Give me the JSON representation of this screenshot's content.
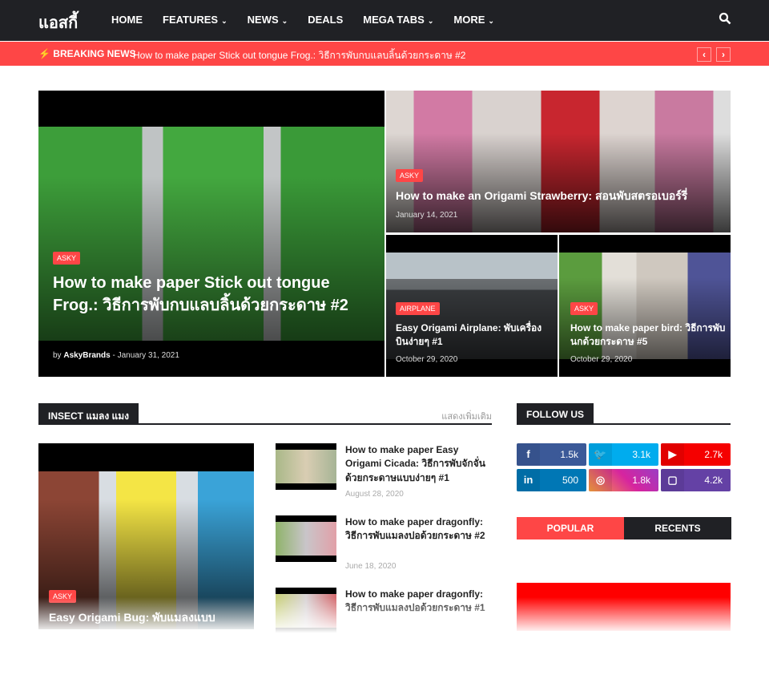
{
  "nav": {
    "logo": "แอสกี้",
    "items": [
      {
        "label": "HOME",
        "chev": false
      },
      {
        "label": "FEATURES",
        "chev": true
      },
      {
        "label": "NEWS",
        "chev": true
      },
      {
        "label": "DEALS",
        "chev": false
      },
      {
        "label": "MEGA TABS",
        "chev": true
      },
      {
        "label": "MORE",
        "chev": true
      }
    ],
    "chevron": "⌄",
    "search_icon": "search-icon"
  },
  "breaking": {
    "label": "BREAKING NEWS",
    "text": "How to make paper Stick out tongue Frog.: วิธีการพับกบแลบลิ้นด้วยกระดาษ #2",
    "prev": "‹",
    "next": "›"
  },
  "featured": [
    {
      "tag": "ASKY",
      "title": "How to make paper Stick out tongue Frog.: วิธีการพับกบแลบลิ้นด้วยกระดาษ #2",
      "author": "AskyBrands",
      "date": "January 31, 2021",
      "by": "by",
      "sep": "-"
    },
    {
      "tag": "ASKY",
      "title": "How to make an Origami Strawberry: สอนพับสตรอเบอร์รี่",
      "date": "January 14, 2021"
    },
    {
      "tag": "AIRPLANE",
      "title": "Easy Origami Airplane: พับเครื่องบินง่ายๆ #1",
      "date": "October 29, 2020"
    },
    {
      "tag": "ASKY",
      "title": "How to make paper bird: วิธีการพับนกด้วยกระดาษ #5",
      "date": "October 29, 2020"
    }
  ],
  "insect": {
    "heading": "INSECT แมลง แมง",
    "more": "แสดงเพิ่มเติม",
    "main": {
      "tag": "ASKY",
      "title": "Easy Origami Bug: พับแมลงแบบ"
    },
    "list": [
      {
        "title": "How to make paper Easy Origami Cicada: วิธีการพับจักจั่นด้วยกระดาษแบบง่ายๆ #1",
        "date": "August 28, 2020"
      },
      {
        "title": "How to make paper dragonfly: วิธีการพับแมลงปอด้วยกระดาษ #2",
        "date": "June 18, 2020"
      },
      {
        "title": "How to make paper dragonfly: วิธีการพับแมลงปอด้วยกระดาษ #1",
        "date": ""
      }
    ]
  },
  "follow": {
    "heading": "FOLLOW US",
    "items": [
      {
        "network": "facebook",
        "icon": "f",
        "count": "1.5k",
        "color": "#3b5998"
      },
      {
        "network": "twitter",
        "icon": "🐦",
        "count": "3.1k",
        "color": "#00acee"
      },
      {
        "network": "youtube",
        "icon": "▶",
        "count": "2.7k",
        "color": "#f50000"
      },
      {
        "network": "linkedin",
        "icon": "in",
        "count": "500",
        "color": "#0077b5"
      },
      {
        "network": "instagram",
        "icon": "◎",
        "count": "1.8k",
        "color": "#d6249f"
      },
      {
        "network": "twitch",
        "icon": "▢",
        "count": "4.2k",
        "color": "#6441a5"
      }
    ]
  },
  "tabs": {
    "popular": "POPULAR",
    "recents": "RECENTS"
  },
  "colors": {
    "accent": "#fe4646",
    "dark": "#202125"
  }
}
